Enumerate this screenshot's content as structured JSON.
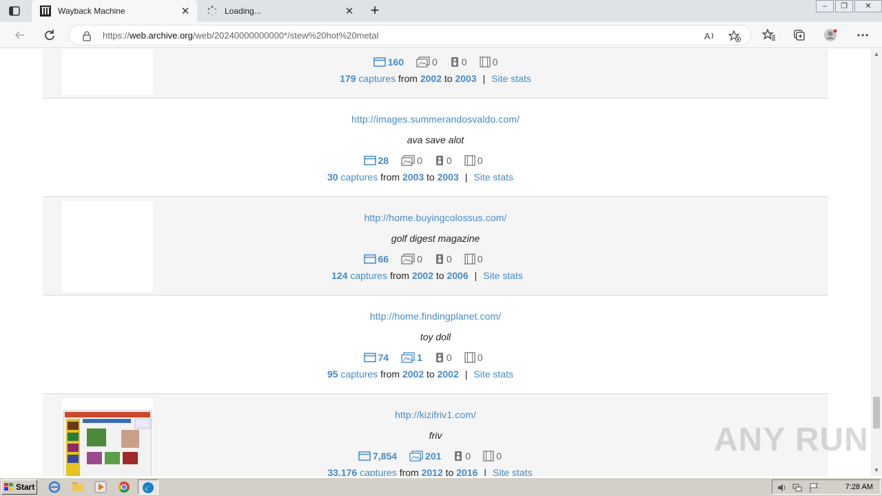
{
  "browser": {
    "tabs": [
      {
        "title": "Wayback Machine",
        "active": true
      },
      {
        "title": "Loading...",
        "active": false
      }
    ],
    "url": {
      "scheme": "https://",
      "domain": "web.archive.org",
      "path": "/web/20240000000000*/stew%20hot%20metal"
    }
  },
  "results": [
    {
      "url": "",
      "title": "",
      "has_thumb": true,
      "pages": "160",
      "images": "0",
      "audio": "0",
      "video": "0",
      "captures": "179",
      "captures_label": "captures",
      "from_label": "from",
      "from": "2002",
      "to_label": "to",
      "to": "2003",
      "site_stats": "Site stats"
    },
    {
      "url": "http://images.summerandosvaldo.com/",
      "title": "ava save alot",
      "has_thumb": false,
      "pages": "28",
      "images": "0",
      "audio": "0",
      "video": "0",
      "captures": "30",
      "captures_label": "captures",
      "from_label": "from",
      "from": "2003",
      "to_label": "to",
      "to": "2003",
      "site_stats": "Site stats"
    },
    {
      "url": "http://home.buyingcolossus.com/",
      "title": "golf digest magazine",
      "has_thumb": true,
      "pages": "66",
      "images": "0",
      "audio": "0",
      "video": "0",
      "captures": "124",
      "captures_label": "captures",
      "from_label": "from",
      "from": "2002",
      "to_label": "to",
      "to": "2006",
      "site_stats": "Site stats"
    },
    {
      "url": "http://home.findingplanet.com/",
      "title": "toy doll",
      "has_thumb": false,
      "pages": "74",
      "images": "1",
      "audio": "0",
      "video": "0",
      "captures": "95",
      "captures_label": "captures",
      "from_label": "from",
      "from": "2002",
      "to_label": "to",
      "to": "2002",
      "site_stats": "Site stats"
    },
    {
      "url": "http://kizifriv1.com/",
      "title": "friv",
      "has_thumb": true,
      "pages": "7,854",
      "images": "201",
      "audio": "0",
      "video": "0",
      "captures": "33,176",
      "captures_label": "captures",
      "from_label": "from",
      "from": "2012",
      "to_label": "to",
      "to": "2016",
      "site_stats": "Site stats"
    }
  ],
  "watermark": "ANY RUN",
  "taskbar": {
    "start": "Start",
    "clock": "7:28 AM"
  },
  "colors": {
    "link": "#428bca",
    "row_alt": "#f5f5f5"
  }
}
